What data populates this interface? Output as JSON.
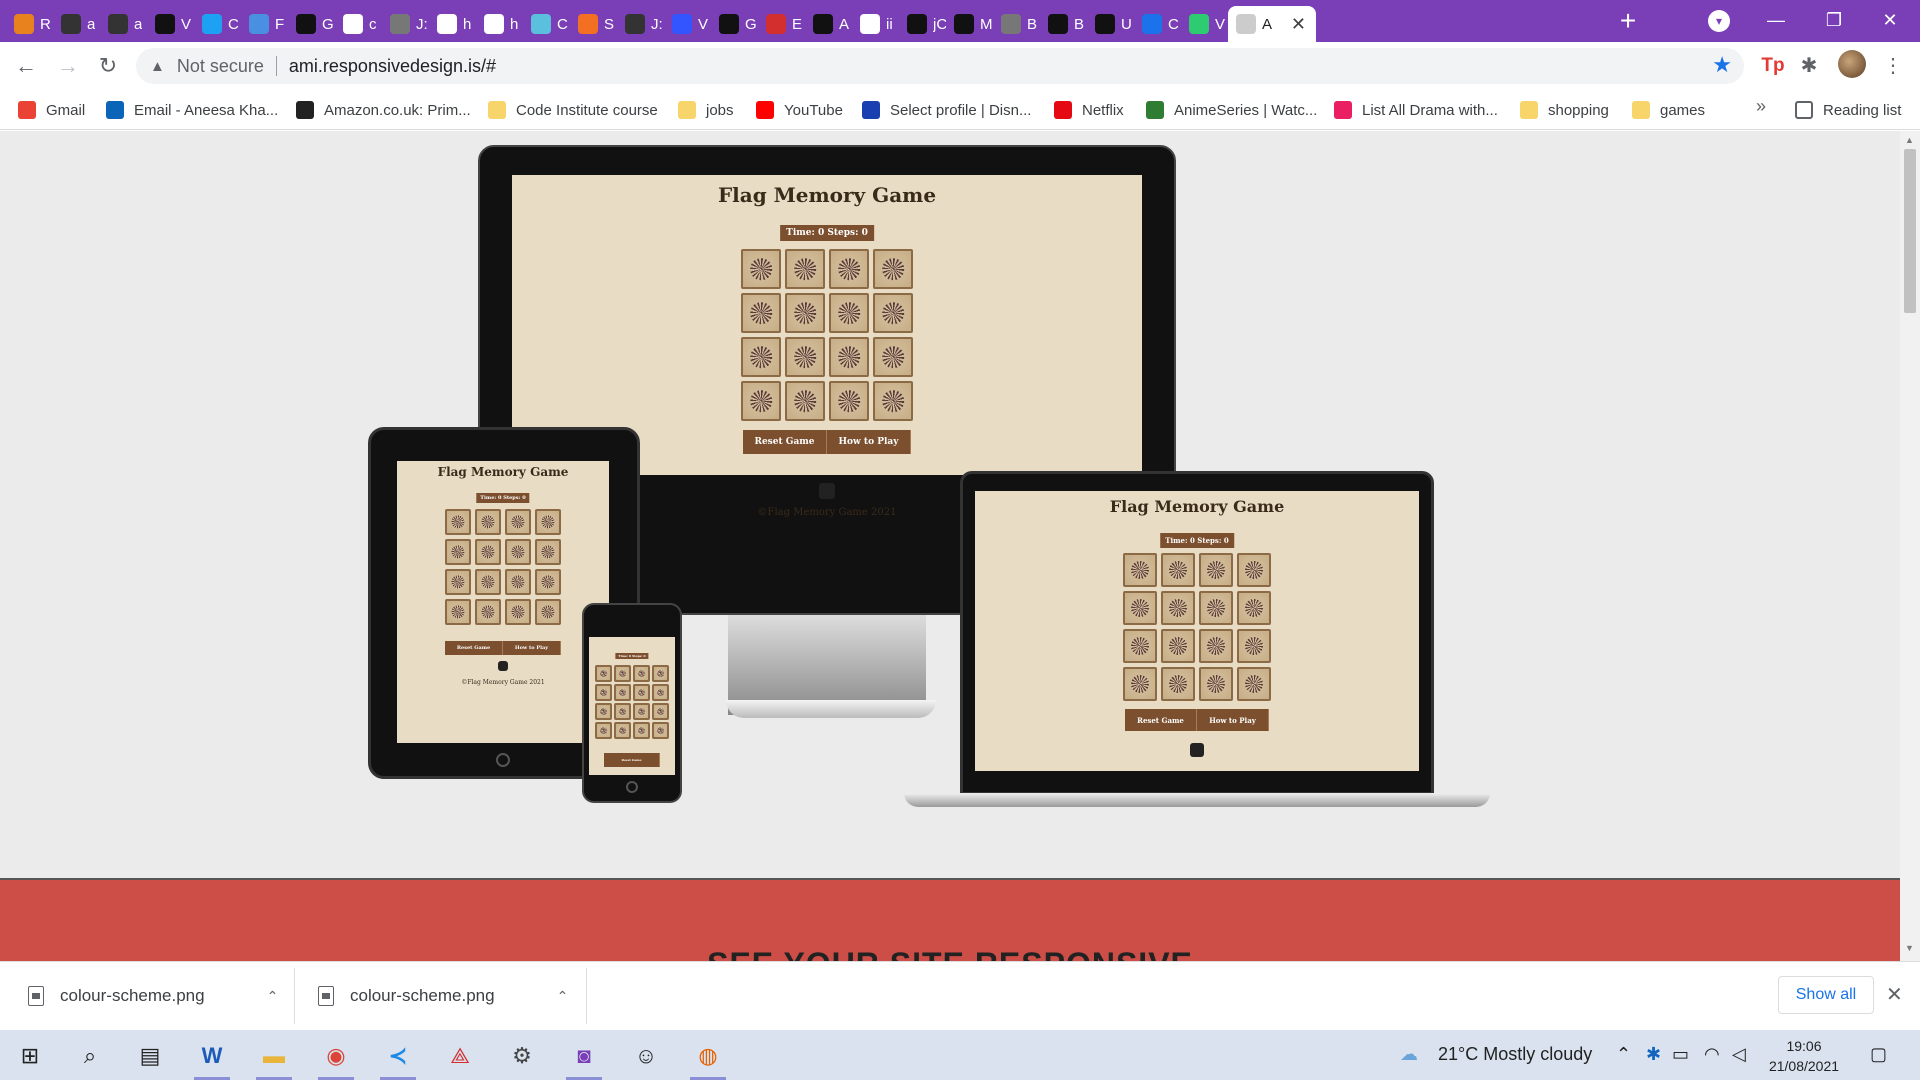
{
  "colors": {
    "accent": "#7a3fb6",
    "brand_red": "#cc4e46",
    "game_bg": "#e8dcc4",
    "game_brown": "#7c4f2e"
  },
  "tabs": [
    {
      "label": "R",
      "icon": "g-orange-icon"
    },
    {
      "label": "a",
      "icon": "github-icon"
    },
    {
      "label": "a",
      "icon": "github-icon"
    },
    {
      "label": "V",
      "icon": "w-black-icon"
    },
    {
      "label": "C",
      "icon": "b-blue-icon"
    },
    {
      "label": "F",
      "icon": "flag-icon"
    },
    {
      "label": "G",
      "icon": "b-black-icon"
    },
    {
      "label": "c",
      "icon": "google-icon"
    },
    {
      "label": "J:",
      "icon": "globe-icon"
    },
    {
      "label": "h",
      "icon": "google-icon"
    },
    {
      "label": "h",
      "icon": "google-icon"
    },
    {
      "label": "C",
      "icon": "map-icon"
    },
    {
      "label": "S",
      "icon": "s-flame-icon"
    },
    {
      "label": "J:",
      "icon": "j-icon"
    },
    {
      "label": "V",
      "icon": "y-icon"
    },
    {
      "label": "G",
      "icon": "dev-icon"
    },
    {
      "label": "E",
      "icon": "e-red-icon"
    },
    {
      "label": "A",
      "icon": "b-black-icon"
    },
    {
      "label": "ii",
      "icon": "google-icon"
    },
    {
      "label": "jC",
      "icon": "codepen-icon"
    },
    {
      "label": "M",
      "icon": "medium-icon"
    },
    {
      "label": "B",
      "icon": "globe-icon"
    },
    {
      "label": "B",
      "icon": "circle-icon"
    },
    {
      "label": "U",
      "icon": "speech-icon"
    },
    {
      "label": "C",
      "icon": "c-blue-icon"
    },
    {
      "label": "V",
      "icon": "px-icon"
    },
    {
      "label": "A",
      "icon": "a-icon",
      "active": true
    }
  ],
  "address_bar": {
    "security": "Not secure",
    "url": "ami.responsivedesign.is/#"
  },
  "bookmarks": [
    {
      "label": "Gmail",
      "icon": "gmail-icon"
    },
    {
      "label": "Email - Aneesa Kha...",
      "icon": "outlook-icon"
    },
    {
      "label": "Amazon.co.uk: Prim...",
      "icon": "amazon-icon"
    },
    {
      "label": "Code Institute course",
      "icon": "folder-icon"
    },
    {
      "label": "jobs",
      "icon": "folder-icon"
    },
    {
      "label": "YouTube",
      "icon": "youtube-icon"
    },
    {
      "label": "Select profile | Disn...",
      "icon": "disney-icon"
    },
    {
      "label": "Netflix",
      "icon": "netflix-icon"
    },
    {
      "label": "AnimeSeries | Watc...",
      "icon": "anime-icon"
    },
    {
      "label": "List All Drama with...",
      "icon": "drama-icon"
    },
    {
      "label": "shopping",
      "icon": "folder-icon"
    },
    {
      "label": "games",
      "icon": "folder-icon"
    }
  ],
  "reading_list": "Reading list",
  "game": {
    "title": "Flag Memory Game",
    "stats": "Time: 0 Steps: 0",
    "reset_label": "Reset Game",
    "howto_label": "How to Play",
    "footer": "©Flag Memory Game 2021"
  },
  "page_heading": "SEE YOUR SITE RESPONSIVE",
  "downloads": [
    {
      "filename": "colour-scheme.png"
    },
    {
      "filename": "colour-scheme.png"
    }
  ],
  "show_all": "Show all",
  "taskbar": {
    "weather": "21°C  Mostly cloudy",
    "time": "19:06",
    "date": "21/08/2021"
  }
}
